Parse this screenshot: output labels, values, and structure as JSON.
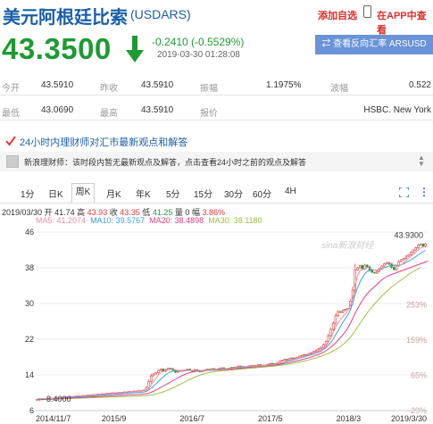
{
  "header": {
    "title": "美元阿根廷比索",
    "code": "(USDARS)",
    "add_watch": "添加自选",
    "app_watch": "在APP中查看"
  },
  "price": {
    "current": "43.3500",
    "change": "-0.2410 (-0.5529%)",
    "time": "2019-03-30 01:28:08",
    "color": "#1e9a32"
  },
  "reverse_button": "⇄ 查看反向汇率 ARSUSD",
  "quote": {
    "row1": [
      {
        "label": "今开",
        "value": "43.5910"
      },
      {
        "label": "昨收",
        "value": "43.5910"
      },
      {
        "label": "振幅",
        "value": "1.1975%"
      },
      {
        "label": "波幅",
        "value": "0.522"
      }
    ],
    "row2": [
      {
        "label": "最低",
        "value": "43.0690"
      },
      {
        "label": "最高",
        "value": "43.5910"
      },
      {
        "label": "报价",
        "value": "HSBC. New York"
      }
    ]
  },
  "news": {
    "heading": "24小时内理财师对汇市最新观点和解答",
    "source": "新浪理财师：",
    "text": "该时段内暂无最新观点及解答，点击查看24小时之前的观点及解答"
  },
  "tabs": [
    "1分",
    "日K",
    "周K",
    "月K",
    "年K",
    "5分",
    "15分",
    "30分",
    "60分",
    "4H"
  ],
  "active_tab": "周K",
  "kline_info": {
    "date": "2019/03/30",
    "open_label": "开",
    "open": "41.74",
    "high_label": "高",
    "high": "43.93",
    "close_label": "收",
    "close": "43.35",
    "low_label": "低",
    "low": "41.25",
    "vol_label": "量",
    "vol": "0",
    "amp_label": "幅",
    "amp": "3.86%"
  },
  "ma_info": {
    "ma5": "MA5: 41.2074",
    "ma10": "MA10: 39.5767",
    "ma20": "MA20: 38.4898",
    "ma30": "MA30: 38.1180"
  },
  "colors": {
    "up": "#e03a3a",
    "down": "#1e9a32",
    "ma5": "#f08ca0",
    "ma10": "#3aa0d8",
    "ma20": "#e04080",
    "ma30": "#a0c040",
    "brand_blue": "#1a5fa8"
  },
  "chart_data": {
    "type": "candlestick",
    "y_ticks": [
      6,
      14,
      22,
      30,
      38,
      46
    ],
    "pct_ticks": [
      "-29%",
      "65%",
      "159%",
      "253%"
    ],
    "x_ticks": [
      "2014/11/7",
      "2015/9",
      "2016/7",
      "2017/5",
      "2018/3",
      "2019/3/30"
    ],
    "high_label": "43.9300",
    "low_label": "8.4000",
    "watermark": "sina新浪财经",
    "ylim": [
      6,
      46
    ],
    "xlim": [
      0,
      230
    ],
    "close": [
      8.5,
      8.5,
      8.6,
      8.6,
      8.7,
      8.7,
      8.8,
      8.8,
      8.9,
      8.9,
      9.0,
      9.0,
      9.1,
      9.1,
      9.2,
      9.2,
      9.3,
      9.3,
      9.3,
      9.4,
      9.4,
      9.5,
      9.5,
      9.6,
      9.6,
      9.7,
      9.7,
      9.8,
      9.8,
      9.9,
      9.9,
      10.0,
      10.0,
      10.0,
      10.1,
      10.1,
      10.2,
      10.2,
      10.3,
      10.3,
      10.4,
      10.4,
      10.5,
      10.5,
      10.6,
      11.2,
      12.5,
      13.8,
      14.2,
      14.5,
      15.0,
      15.3,
      14.8,
      15.2,
      15.5,
      15.4,
      15.0,
      14.6,
      14.8,
      15.0,
      14.9,
      15.1,
      15.3,
      15.0,
      14.8,
      15.2,
      15.0,
      14.7,
      14.9,
      15.1,
      15.3,
      15.2,
      15.4,
      15.1,
      15.3,
      15.5,
      15.6,
      15.4,
      15.3,
      15.5,
      15.7,
      15.6,
      15.8,
      16.0,
      15.9,
      15.7,
      15.8,
      16.0,
      16.1,
      15.9,
      16.1,
      16.3,
      16.2,
      16.0,
      16.2,
      16.4,
      16.6,
      16.5,
      16.4,
      16.7,
      17.1,
      17.3,
      17.5,
      17.4,
      17.7,
      17.8,
      17.6,
      17.9,
      18.2,
      18.4,
      18.6,
      18.5,
      18.8,
      19.0,
      19.3,
      19.6,
      19.9,
      20.2,
      20.8,
      21.5,
      22.8,
      24.2,
      25.6,
      27.3,
      28.2,
      28.0,
      28.5,
      28.7,
      28.9,
      30.5,
      33.0,
      37.5,
      38.0,
      38.5,
      37.8,
      38.6,
      38.2,
      37.4,
      37.0,
      36.8,
      37.2,
      37.8,
      38.4,
      38.9,
      39.2,
      38.8,
      38.1,
      37.6,
      38.5,
      39.4,
      39.8,
      40.1,
      40.6,
      40.9,
      41.5,
      42.0,
      42.5,
      43.1,
      43.3,
      42.8,
      43.35
    ],
    "ma5": [
      8.5,
      8.5,
      8.55,
      8.58,
      8.62,
      8.66,
      8.72,
      8.76,
      8.82,
      8.86,
      8.92,
      8.96,
      9.02,
      9.06,
      9.12,
      9.16,
      9.22,
      9.26,
      9.28,
      9.32,
      9.36,
      9.4,
      9.44,
      9.48,
      9.52,
      9.58,
      9.62,
      9.68,
      9.72,
      9.78,
      9.82,
      9.88,
      9.92,
      9.94,
      9.98,
      10.04,
      10.08,
      10.12,
      10.18,
      10.22,
      10.28,
      10.32,
      10.38,
      10.42,
      10.48,
      10.64,
      11.0,
      11.72,
      12.54,
      13.24,
      14.0,
      14.56,
      14.76,
      15.0,
      15.16,
      15.28,
      15.26,
      15.14,
      15.06,
      15.0,
      14.96,
      14.9,
      15.02,
      15.06,
      15.02,
      15.08,
      15.06,
      14.94,
      14.92,
      14.98,
      15.0,
      15.04,
      15.18,
      15.22,
      15.26,
      15.3,
      15.38,
      15.38,
      15.38,
      15.46,
      15.5,
      15.5,
      15.58,
      15.72,
      15.8,
      15.8,
      15.84,
      15.88,
      15.9,
      15.9,
      15.96,
      16.04,
      16.12,
      16.1,
      16.16,
      16.2,
      16.3,
      16.34,
      16.34,
      16.52,
      16.66,
      16.8,
      16.94,
      17.2,
      17.4,
      17.46,
      17.6,
      17.68,
      17.82,
      18.04,
      18.22,
      18.4,
      18.5,
      18.7,
      18.86,
      19.04,
      19.32,
      19.6,
      19.94,
      20.4,
      21.24,
      22.26,
      23.44,
      24.8,
      25.6,
      26.5,
      27.12,
      27.74,
      28.46,
      29.52,
      31.28,
      34.12,
      36.2,
      37.4,
      37.58,
      37.8,
      38.02,
      37.96,
      37.66,
      37.48,
      37.46,
      37.62,
      37.98,
      38.42,
      38.88,
      39.1,
      39.04,
      38.72,
      38.4,
      38.36,
      38.68,
      39.06,
      39.58,
      40.16,
      40.58,
      41.02,
      41.5,
      42.0,
      42.4,
      42.68,
      42.92
    ],
    "ma10": [
      8.5,
      8.5,
      8.52,
      8.55,
      8.58,
      8.6,
      8.64,
      8.68,
      8.72,
      8.76,
      8.8,
      8.84,
      8.88,
      8.92,
      8.96,
      9.0,
      9.04,
      9.08,
      9.12,
      9.16,
      9.2,
      9.24,
      9.28,
      9.32,
      9.36,
      9.4,
      9.44,
      9.48,
      9.52,
      9.56,
      9.6,
      9.64,
      9.68,
      9.72,
      9.76,
      9.8,
      9.84,
      9.88,
      9.92,
      9.96,
      10.0,
      10.04,
      10.08,
      10.12,
      10.16,
      10.3,
      10.6,
      11.0,
      11.5,
      12.0,
      12.5,
      13.1,
      13.5,
      14.0,
      14.4,
      14.7,
      14.9,
      15.0,
      15.0,
      15.0,
      15.05,
      15.0,
      15.0,
      15.05,
      15.0,
      15.0,
      15.0,
      15.0,
      15.0,
      15.0,
      15.0,
      15.05,
      15.1,
      15.1,
      15.15,
      15.2,
      15.25,
      15.3,
      15.35,
      15.4,
      15.45,
      15.5,
      15.55,
      15.6,
      15.65,
      15.7,
      15.75,
      15.8,
      15.85,
      15.9,
      15.95,
      16.0,
      16.05,
      16.1,
      16.15,
      16.2,
      16.25,
      16.3,
      16.35,
      16.45,
      16.55,
      16.7,
      16.85,
      17.0,
      17.15,
      17.3,
      17.45,
      17.6,
      17.75,
      17.9,
      18.05,
      18.2,
      18.35,
      18.5,
      18.7,
      18.9,
      19.1,
      19.35,
      19.7,
      20.1,
      20.6,
      21.3,
      22.1,
      23.0,
      23.9,
      24.9,
      25.8,
      26.6,
      27.4,
      28.5,
      30.0,
      32.0,
      33.5,
      34.8,
      35.8,
      36.6,
      37.2,
      37.5,
      37.5,
      37.5,
      37.5,
      37.6,
      37.8,
      38.0,
      38.2,
      38.4,
      38.5,
      38.5,
      38.4,
      38.5,
      38.7,
      38.9,
      39.2,
      39.5,
      39.8,
      40.1,
      40.5,
      40.9,
      41.3,
      41.6,
      41.9
    ],
    "ma20": [
      8.5,
      8.5,
      8.5,
      8.52,
      8.54,
      8.56,
      8.58,
      8.6,
      8.63,
      8.66,
      8.69,
      8.72,
      8.75,
      8.78,
      8.81,
      8.84,
      8.87,
      8.9,
      8.93,
      8.96,
      8.99,
      9.02,
      9.05,
      9.08,
      9.11,
      9.14,
      9.17,
      9.2,
      9.23,
      9.26,
      9.29,
      9.32,
      9.35,
      9.38,
      9.41,
      9.44,
      9.47,
      9.5,
      9.53,
      9.56,
      9.59,
      9.62,
      9.65,
      9.68,
      9.71,
      9.78,
      9.9,
      10.1,
      10.35,
      10.6,
      10.9,
      11.2,
      11.5,
      11.8,
      12.1,
      12.4,
      12.7,
      13.0,
      13.3,
      13.6,
      13.9,
      14.15,
      14.35,
      14.5,
      14.65,
      14.75,
      14.85,
      14.9,
      14.95,
      15.0,
      15.0,
      15.0,
      15.05,
      15.05,
      15.1,
      15.1,
      15.15,
      15.2,
      15.2,
      15.25,
      15.3,
      15.35,
      15.4,
      15.45,
      15.5,
      15.55,
      15.6,
      15.65,
      15.7,
      15.75,
      15.8,
      15.85,
      15.9,
      15.95,
      16.0,
      16.05,
      16.1,
      16.15,
      16.2,
      16.28,
      16.36,
      16.46,
      16.56,
      16.66,
      16.78,
      16.9,
      17.02,
      17.14,
      17.28,
      17.42,
      17.56,
      17.7,
      17.85,
      18.0,
      18.2,
      18.4,
      18.6,
      18.85,
      19.1,
      19.4,
      19.8,
      20.2,
      20.7,
      21.2,
      21.8,
      22.4,
      23.0,
      23.7,
      24.5,
      25.5,
      26.6,
      27.8,
      28.8,
      29.8,
      30.7,
      31.5,
      32.2,
      32.8,
      33.3,
      33.8,
      34.3,
      34.8,
      35.3,
      35.7,
      36.0,
      36.3,
      36.5,
      36.7,
      36.9,
      37.1,
      37.3,
      37.5,
      37.7,
      37.9,
      38.1,
      38.3,
      38.5,
      38.7,
      38.9,
      39.1,
      39.3,
      39.5
    ],
    "ma30": [
      8.5,
      8.5,
      8.5,
      8.51,
      8.52,
      8.54,
      8.56,
      8.58,
      8.6,
      8.62,
      8.64,
      8.66,
      8.68,
      8.7,
      8.72,
      8.74,
      8.76,
      8.78,
      8.8,
      8.82,
      8.84,
      8.86,
      8.88,
      8.9,
      8.92,
      8.94,
      8.96,
      8.98,
      9.0,
      9.02,
      9.04,
      9.06,
      9.08,
      9.1,
      9.12,
      9.14,
      9.16,
      9.18,
      9.2,
      9.22,
      9.24,
      9.26,
      9.28,
      9.3,
      9.32,
      9.36,
      9.42,
      9.5,
      9.6,
      9.72,
      9.86,
      10.02,
      10.2,
      10.4,
      10.62,
      10.86,
      11.1,
      11.36,
      11.62,
      11.9,
      12.18,
      12.46,
      12.74,
      13.0,
      13.26,
      13.5,
      13.72,
      13.92,
      14.1,
      14.26,
      14.4,
      14.52,
      14.62,
      14.7,
      14.78,
      14.84,
      14.9,
      14.95,
      15.0,
      15.05,
      15.1,
      15.15,
      15.2,
      15.25,
      15.3,
      15.35,
      15.4,
      15.45,
      15.5,
      15.55,
      15.6,
      15.65,
      15.7,
      15.75,
      15.8,
      15.85,
      15.9,
      15.95,
      16.0,
      16.06,
      16.12,
      16.2,
      16.28,
      16.36,
      16.46,
      16.56,
      16.66,
      16.76,
      16.88,
      17.0,
      17.12,
      17.24,
      17.38,
      17.52,
      17.68,
      17.84,
      18.0,
      18.2,
      18.4,
      18.6,
      18.85,
      19.1,
      19.4,
      19.7,
      20.0,
      20.4,
      20.8,
      21.3,
      21.8,
      22.4,
      23.1,
      23.9,
      24.7,
      25.5,
      26.3,
      27.1,
      27.9,
      28.6,
      29.3,
      29.9,
      30.5,
      31.1,
      31.7,
      32.2,
      32.7,
      33.2,
      33.7,
      34.1,
      34.5,
      34.9,
      35.3,
      35.7,
      36.1,
      36.5,
      36.9,
      37.2,
      37.5,
      37.8,
      38.1
    ]
  }
}
